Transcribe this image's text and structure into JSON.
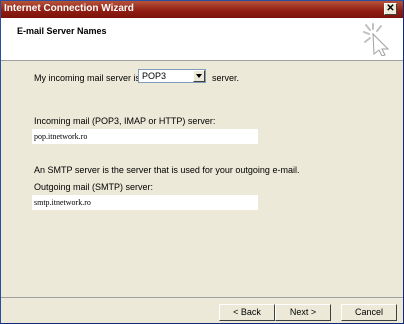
{
  "window": {
    "title": "Internet Connection Wizard",
    "close_label": "✕"
  },
  "header": {
    "title": "E-mail Server Names"
  },
  "form": {
    "incoming_prefix": "My incoming mail server is a",
    "server_type": "POP3",
    "incoming_suffix": "server.",
    "incoming_label": "Incoming mail (POP3, IMAP or HTTP) server:",
    "incoming_value": "pop.itnetwork.ro",
    "smtp_description": "An SMTP server is the server that is used for your outgoing e-mail.",
    "outgoing_label": "Outgoing mail (SMTP) server:",
    "outgoing_value": "smtp.itnetwork.ro"
  },
  "buttons": {
    "back": "< Back",
    "next": "Next >",
    "cancel": "Cancel"
  }
}
